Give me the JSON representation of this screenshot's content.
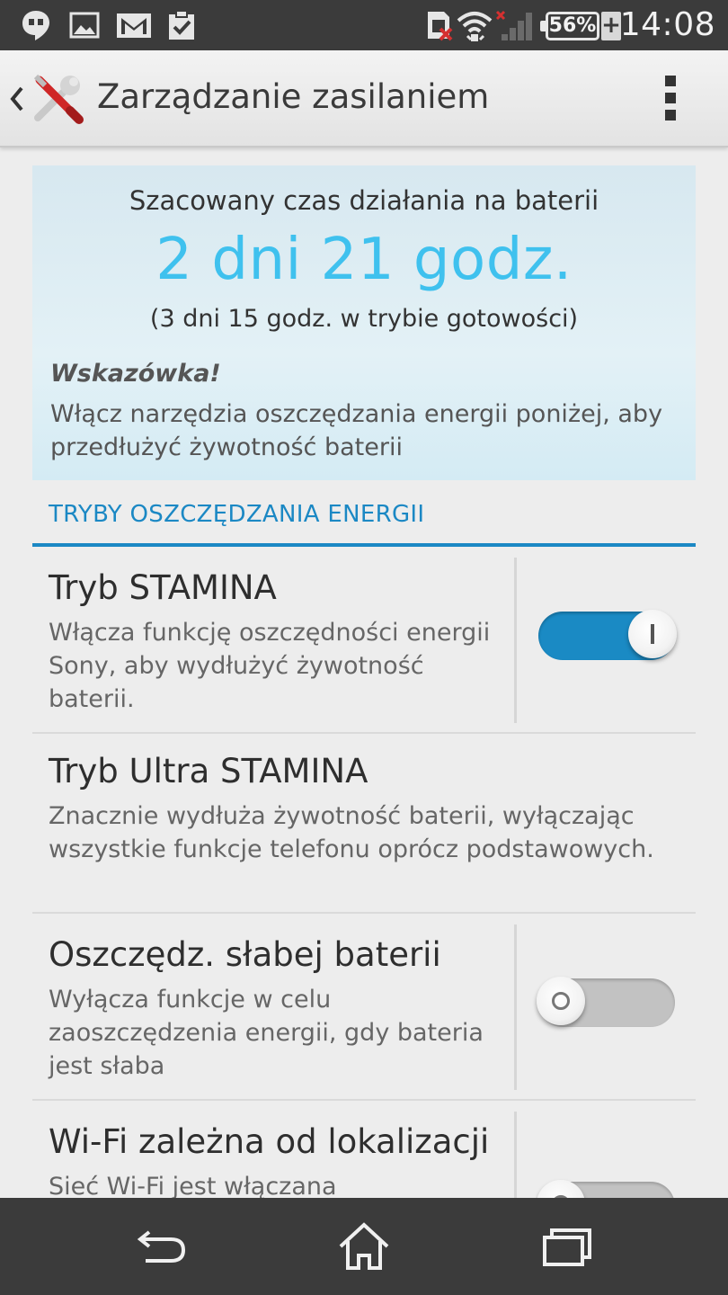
{
  "status_bar": {
    "time": "14:08",
    "battery_percent": "56%",
    "charging_symbol": "+",
    "icons": [
      "hangouts-icon",
      "image-icon",
      "gmail-icon",
      "clipboard-check-icon",
      "sim-error-icon",
      "wifi-icon",
      "signal-no-service-icon",
      "battery-icon"
    ]
  },
  "action_bar": {
    "title": "Zarządzanie zasilaniem",
    "back_icon": "chevron-left-icon",
    "app_icon": "tools-icon",
    "overflow_icon": "overflow-menu-icon"
  },
  "battery_info": {
    "estimate_label": "Szacowany czas działania na baterii",
    "estimate_value": "2 dni 21 godz.",
    "standby": "(3 dni 15 godz. w trybie gotowości)",
    "tip_title": "Wskazówka!",
    "tip_text": "Włącz narzędzia oszczędzania energii poniżej, aby przedłużyć żywotność baterii"
  },
  "section": {
    "header": "TRYBY OSZCZĘDZANIA ENERGII"
  },
  "items": [
    {
      "title": "Tryb STAMINA",
      "desc": "Włącza funkcję oszczędności energii Sony, aby wydłużyć żywotność baterii.",
      "toggle": "on"
    },
    {
      "title": "Tryb Ultra STAMINA",
      "desc": "Znacznie wydłuża żywotność baterii, wyłączając wszystkie funkcje telefonu oprócz podstawowych."
    },
    {
      "title": "Oszczędz. słabej baterii",
      "desc": "Wyłącza funkcje w celu zaoszczędzenia energii, gdy bateria jest słaba",
      "toggle": "off"
    },
    {
      "title": "Wi-Fi zależna od lokalizacji",
      "desc": "Sieć Wi-Fi jest włączana",
      "toggle": "off"
    }
  ],
  "colors": {
    "accent": "#1b88c4",
    "estimate": "#3fc1ee",
    "status_bar": "#3b3b3b"
  },
  "nav_bar": {
    "icons": [
      "back-icon",
      "home-icon",
      "recent-apps-icon"
    ]
  }
}
